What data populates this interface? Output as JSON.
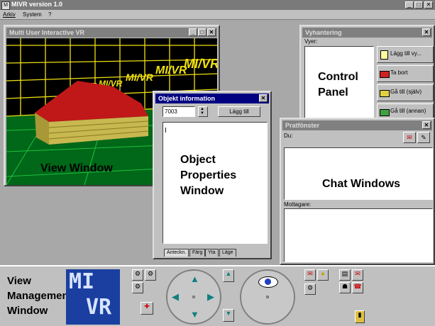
{
  "app": {
    "title": "MIVR version 1.0"
  },
  "menu": {
    "items": [
      "Arkiv",
      "System",
      "?"
    ]
  },
  "view_window": {
    "title": "Multi User Interactive VR",
    "callout": "View Window",
    "sign_text": "MI/VR"
  },
  "object_info": {
    "title": "Objekt information",
    "id_value": "7003",
    "add_label": "Lägg till",
    "cursor": "I",
    "callout_lines": [
      "Object",
      "Properties",
      "Window"
    ],
    "tabs": [
      "Anteckn.",
      "Färg",
      "Yta",
      "Läge"
    ]
  },
  "view_mgmt": {
    "title": "Vyhantering",
    "list_label": "Vyer:",
    "callout_lines": [
      "Control",
      "Panel"
    ],
    "buttons": [
      "Lägg till vy...",
      "Ta bort",
      "Gå till (själv)",
      "Gå till (annan)"
    ]
  },
  "chat": {
    "title": "Pratfönster",
    "you_label": "Du:",
    "callout": "Chat Windows",
    "recipients_label": "Mottagare:"
  },
  "bottom": {
    "callout_lines": [
      "View",
      "Management",
      "Window"
    ],
    "logo_lines": [
      "MI",
      "VR"
    ]
  },
  "colors": {
    "titlebar": "#000080",
    "desktop": "#a8a8a8",
    "logo_bg": "#1a3fa0",
    "grid": "#f0e010",
    "floor": "#006818"
  }
}
